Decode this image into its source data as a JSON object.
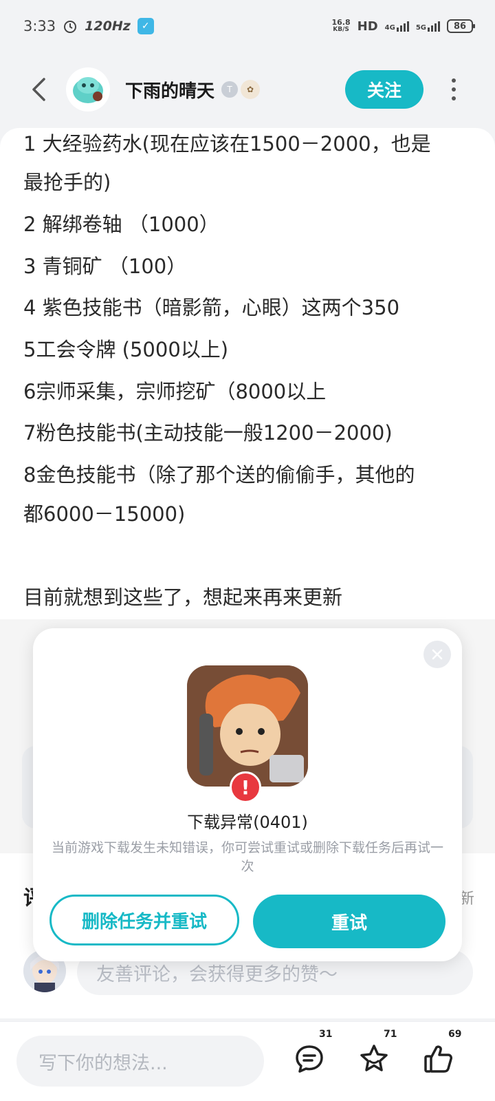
{
  "status_bar": {
    "time": "3:33",
    "refresh_rate": "120Hz",
    "net_speed_value": "16.8",
    "net_speed_unit": "KB/S",
    "hd_label": "HD",
    "signal1": "4G",
    "signal2": "5G",
    "battery": "86"
  },
  "header": {
    "username": "下雨的晴天",
    "follow_label": "关注"
  },
  "post": {
    "lines": [
      "1 大经验药水(现在应该在1500－2000，也是",
      "最抢手的)",
      "2 解绑卷轴 （1000）",
      "3 青铜矿 （100）",
      "4 紫色技能书（暗影箭，心眼）这两个350",
      "5工会令牌 (5000以上)",
      "6宗师采集，宗师挖矿（8000以上",
      "7粉色技能书(主动技能一般1200－2000)",
      "8金色技能书（除了那个送的偷偷手，其他的",
      "都6000－15000)",
      "目前就想到这些了，想起来再来更新"
    ]
  },
  "modal": {
    "title": "下载异常(0401)",
    "description": "当前游戏下载发生未知错误，你可尝试重试或删除下载任务后再试一次",
    "delete_retry_label": "删除任务并重试",
    "retry_label": "重试"
  },
  "comments": {
    "heading_char": "评",
    "sort_label": "新",
    "input_placeholder": "友善评论，会获得更多的赞～"
  },
  "bottom_bar": {
    "input_placeholder": "写下你的想法...",
    "comment_count": "31",
    "favorite_count": "71",
    "like_count": "69"
  },
  "colors": {
    "accent": "#17b9c6",
    "error": "#e8383f"
  }
}
